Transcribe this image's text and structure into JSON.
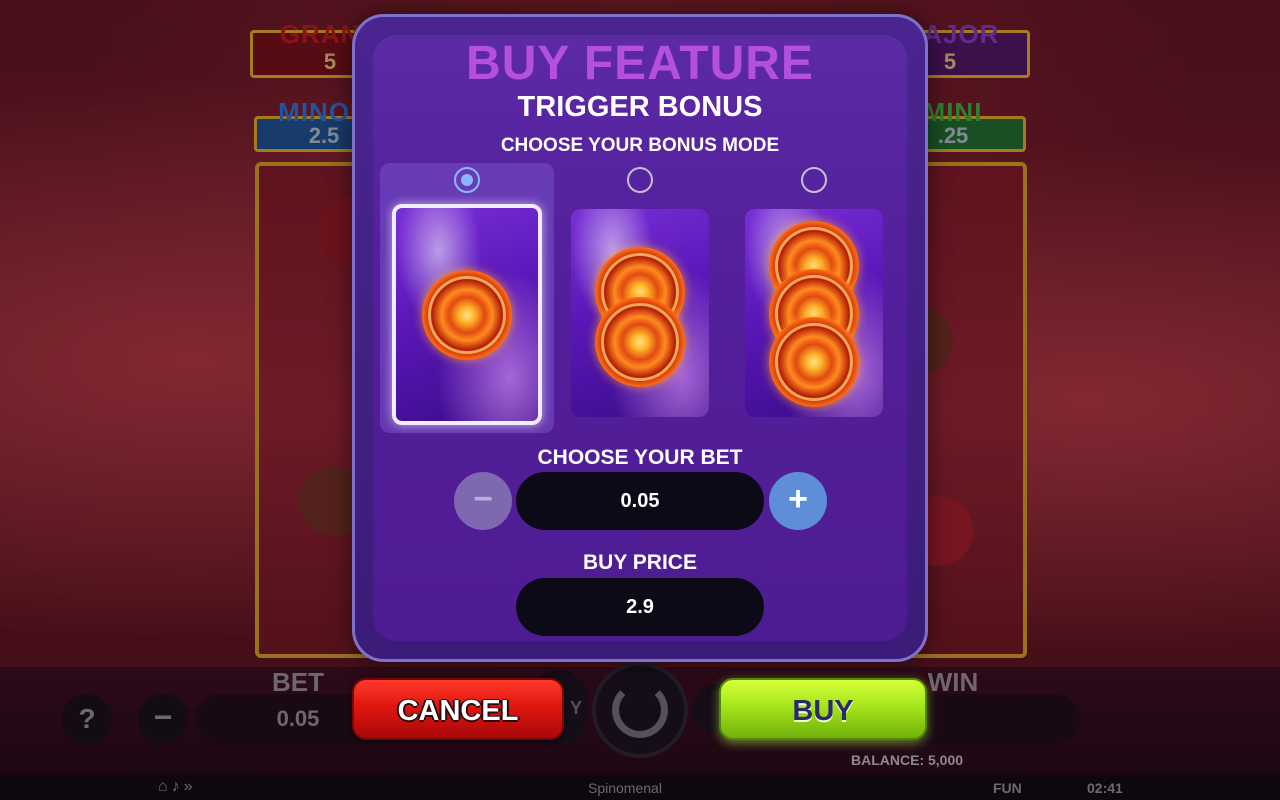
{
  "jackpots": {
    "grand": {
      "name": "GRAND",
      "value": "5"
    },
    "major": {
      "name": "MAJOR",
      "value": "5"
    },
    "minor": {
      "name": "MINOR",
      "value": "2.5"
    },
    "mini": {
      "name": "MINI",
      "value": ".25"
    }
  },
  "bottom_bar": {
    "help_label": "?",
    "minus_label": "−",
    "bet_label": "BET",
    "bet_value": "0.05",
    "buy_label": "Y",
    "win_label": "WIN",
    "balance": "BALANCE: 5,000"
  },
  "footer": {
    "icons": [
      "home-icon",
      "sound-icon",
      "fast-icon"
    ],
    "brand": "Spinomenal",
    "mode": "FUN",
    "clock": "02:41"
  },
  "modal": {
    "title": "BUY FEATURE",
    "subtitle": "TRIGGER BONUS",
    "choose_mode_label": "CHOOSE YOUR BONUS MODE",
    "options": [
      {
        "coins": 1,
        "selected": true
      },
      {
        "coins": 2,
        "selected": false
      },
      {
        "coins": 3,
        "selected": false
      }
    ],
    "choose_bet_label": "CHOOSE YOUR BET",
    "bet_minus": "−",
    "bet_plus": "+",
    "bet_value": "0.05",
    "buy_price_label": "BUY PRICE",
    "buy_price_value": "2.9",
    "cancel_label": "CANCEL",
    "buy_label": "BUY"
  },
  "colors": {
    "title_purple": "#b44fe0",
    "cancel_red": "#e0160f",
    "buy_green": "#a6e61a",
    "radio_selected": "#8ab6ff"
  }
}
